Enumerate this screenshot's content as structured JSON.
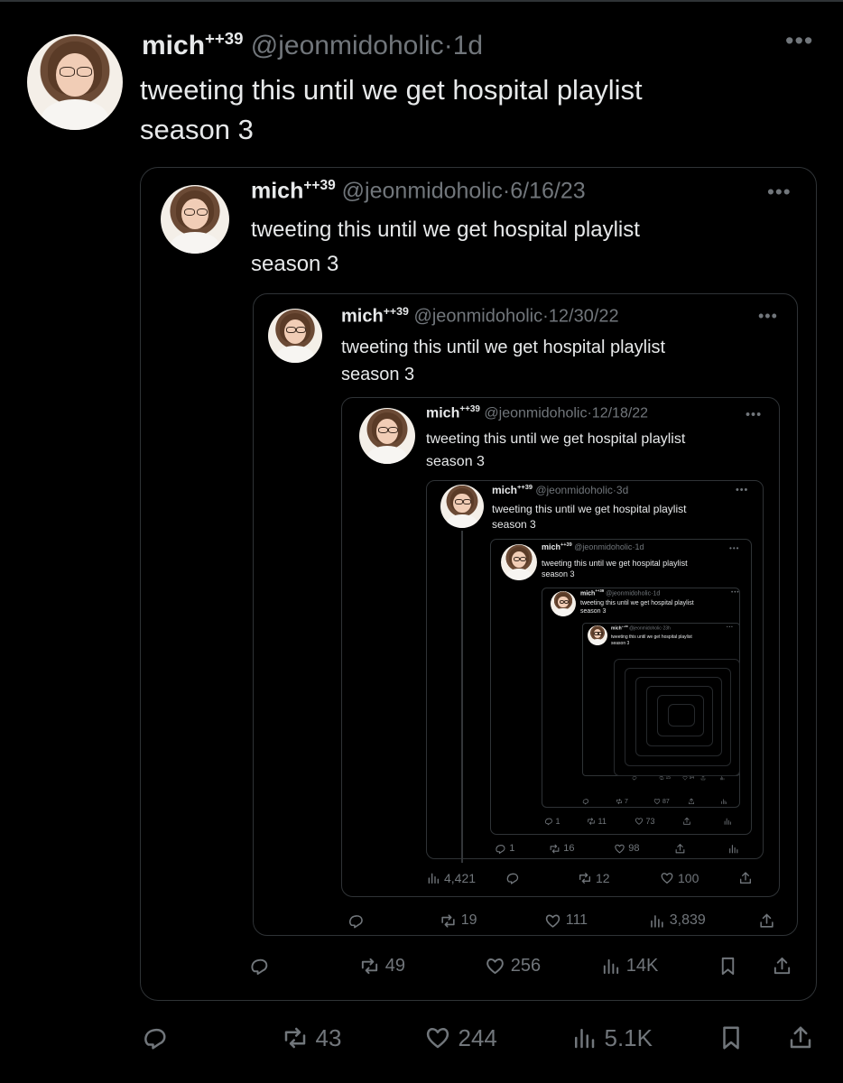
{
  "author": {
    "name": "mich",
    "badge": "++39",
    "handle": "@jeonmidoholic"
  },
  "text": [
    "tweeting this until we get hospital playlist",
    "season 3"
  ],
  "levels": [
    {
      "time": "1d",
      "replies": "",
      "retweets": "43",
      "likes": "244",
      "views": "5.1K"
    },
    {
      "time": "6/16/23",
      "replies": "",
      "retweets": "49",
      "likes": "256",
      "views": "14K"
    },
    {
      "time": "12/30/22",
      "replies": "",
      "retweets": "19",
      "likes": "111",
      "views": "3,839"
    },
    {
      "time": "12/18/22",
      "replies": "",
      "retweets": "12",
      "likes": "100",
      "views": "4,421"
    },
    {
      "time": "3d",
      "replies": "1",
      "retweets": "16",
      "likes": "98",
      "views": ""
    },
    {
      "time": "1d",
      "replies": "1",
      "retweets": "11",
      "likes": "73",
      "views": ""
    },
    {
      "time": "1d",
      "replies": "",
      "retweets": "7",
      "likes": "87",
      "views": ""
    },
    {
      "time": "23h",
      "replies": "",
      "retweets": "15",
      "likes": "94",
      "views": ""
    }
  ],
  "colors": {
    "background": "#000000",
    "text": "#e7e9ea",
    "muted": "#71767b",
    "border": "#2f3336"
  },
  "icons": [
    "reply-icon",
    "retweet-icon",
    "like-icon",
    "views-icon",
    "bookmark-icon",
    "share-icon",
    "more-icon"
  ]
}
